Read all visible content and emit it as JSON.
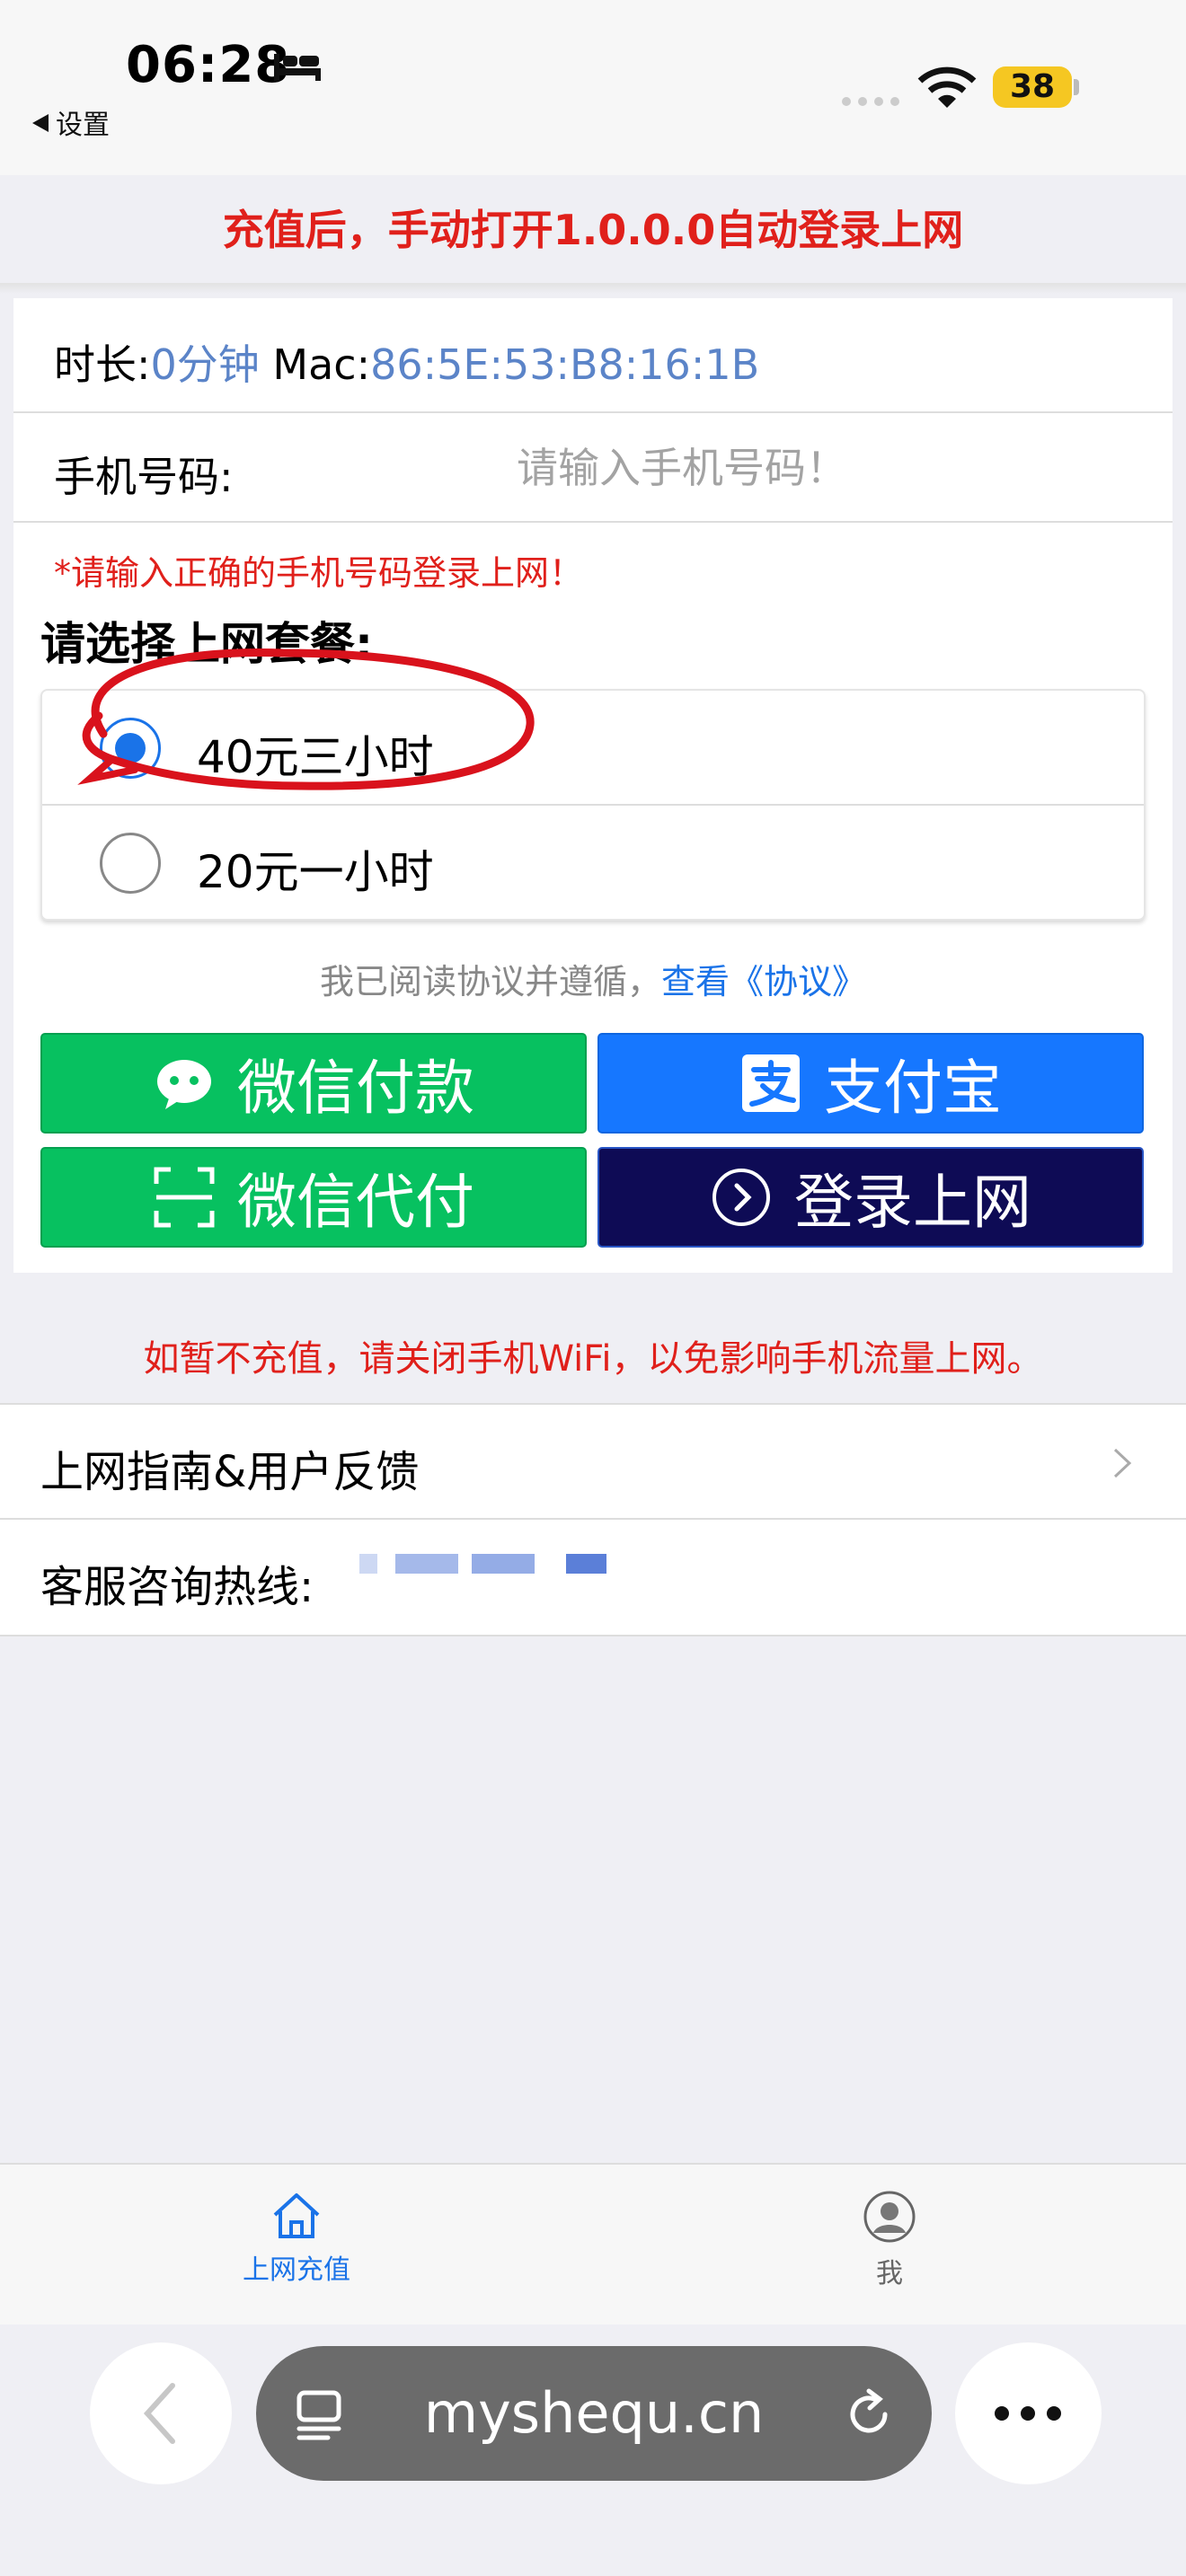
{
  "status": {
    "time": "06:28",
    "back_label": "设置",
    "battery": "38"
  },
  "notice": "充值后，手动打开1.0.0.0自动登录上网",
  "info": {
    "duration_label": "时长:",
    "duration_value": "0分钟",
    "mac_label": "Mac:",
    "mac_value": "86:5E:53:B8:16:1B"
  },
  "phone": {
    "label": "手机号码:",
    "placeholder": "请输入手机号码！"
  },
  "warning": "*请输入正确的手机号码登录上网！",
  "choose_label": "请选择上网套餐:",
  "plans": [
    {
      "label": "40元三小时",
      "selected": true
    },
    {
      "label": "20元一小时",
      "selected": false
    }
  ],
  "agreement": {
    "text": "我已阅读协议并遵循，",
    "link": "查看《协议》"
  },
  "buttons": {
    "wechat_pay": "微信付款",
    "alipay": "支付宝",
    "wechat_proxy": "微信代付",
    "login": "登录上网"
  },
  "tip": "如暂不充值，请关闭手机WiFi，以免影响手机流量上网。",
  "menu": {
    "guide": "上网指南&用户反馈",
    "hotline_label": "客服咨询热线:"
  },
  "tabs": [
    {
      "label": "上网充值"
    },
    {
      "label": "我"
    }
  ],
  "browser": {
    "url": "myshequ.cn"
  },
  "colors": {
    "red": "#e0201b",
    "blue": "#1a73e8",
    "wechat_green": "#07c160",
    "alipay_blue": "#1677ff",
    "login_navy": "#0e0b55"
  }
}
